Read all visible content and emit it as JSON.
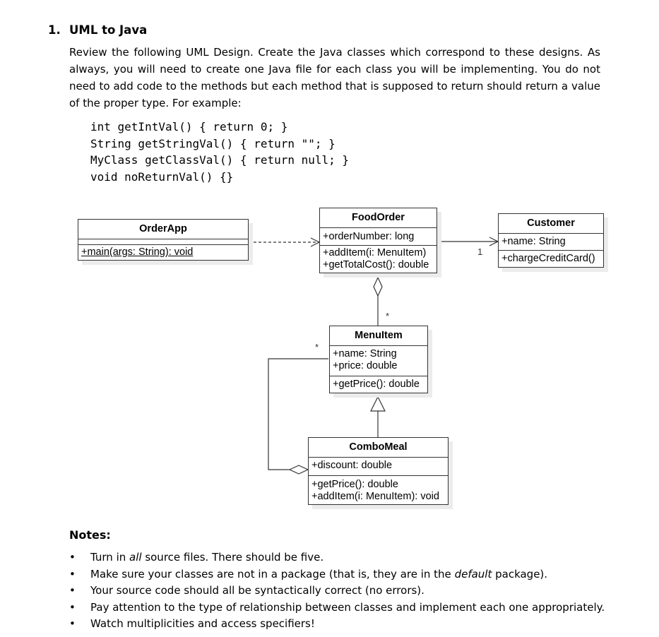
{
  "heading": {
    "number": "1.",
    "title": "UML to Java"
  },
  "intro": "Review the following UML Design. Create the Java classes which correspond to these designs. As always, you will need to create one Java file for each class you will be implementing. You do not need to add code to the methods but each method that is supposed to return should return a value of the proper type. For example:",
  "code_lines": [
    "int getIntVal() { return 0; }",
    "String getStringVal() { return \"\"; }",
    "MyClass getClassVal() { return null; }",
    "void noReturnVal() {}"
  ],
  "uml": {
    "classes": {
      "orderapp": {
        "name": "OrderApp",
        "attributes": [],
        "methods": [
          "+main(args: String): void"
        ]
      },
      "foodorder": {
        "name": "FoodOrder",
        "attributes": [
          "+orderNumber: long"
        ],
        "methods": [
          "+addItem(i: MenuItem)",
          "+getTotalCost(): double"
        ]
      },
      "customer": {
        "name": "Customer",
        "attributes": [
          "+name: String"
        ],
        "methods": [
          "+chargeCreditCard()"
        ]
      },
      "menuitem": {
        "name": "MenuItem",
        "attributes": [
          "+name: String",
          "+price: double"
        ],
        "methods": [
          "+getPrice(): double"
        ]
      },
      "combomeal": {
        "name": "ComboMeal",
        "attributes": [
          "+discount: double"
        ],
        "methods": [
          "+getPrice(): double",
          "+addItem(i: MenuItem): void"
        ]
      }
    },
    "relationships": [
      {
        "type": "dependency",
        "from": "OrderApp",
        "to": "FoodOrder"
      },
      {
        "type": "association",
        "from": "FoodOrder",
        "to": "Customer",
        "multiplicity": "1"
      },
      {
        "type": "aggregation",
        "whole": "FoodOrder",
        "part": "MenuItem",
        "multiplicity": "*"
      },
      {
        "type": "generalization",
        "child": "ComboMeal",
        "parent": "MenuItem"
      },
      {
        "type": "aggregation",
        "whole": "ComboMeal",
        "part": "MenuItem",
        "multiplicity": "*"
      }
    ],
    "multiplicity_labels": {
      "customer": "1",
      "foodorder_menuitem": "*",
      "combo_menuitem": "*"
    }
  },
  "notes": {
    "title": "Notes:",
    "items": [
      {
        "before": "Turn in ",
        "em": "all",
        "after": " source files. There should be five."
      },
      {
        "before": "Make sure your classes are not in a package (that is, they are in the ",
        "em": "default",
        "after": " package)."
      },
      {
        "before": "Your source code should all be syntactically correct (no errors).",
        "em": "",
        "after": ""
      },
      {
        "before": "Pay attention to the type of relationship between classes and implement each one appropriately.",
        "em": "",
        "after": ""
      },
      {
        "before": "Watch multiplicities and access specifiers!",
        "em": "",
        "after": ""
      }
    ]
  }
}
